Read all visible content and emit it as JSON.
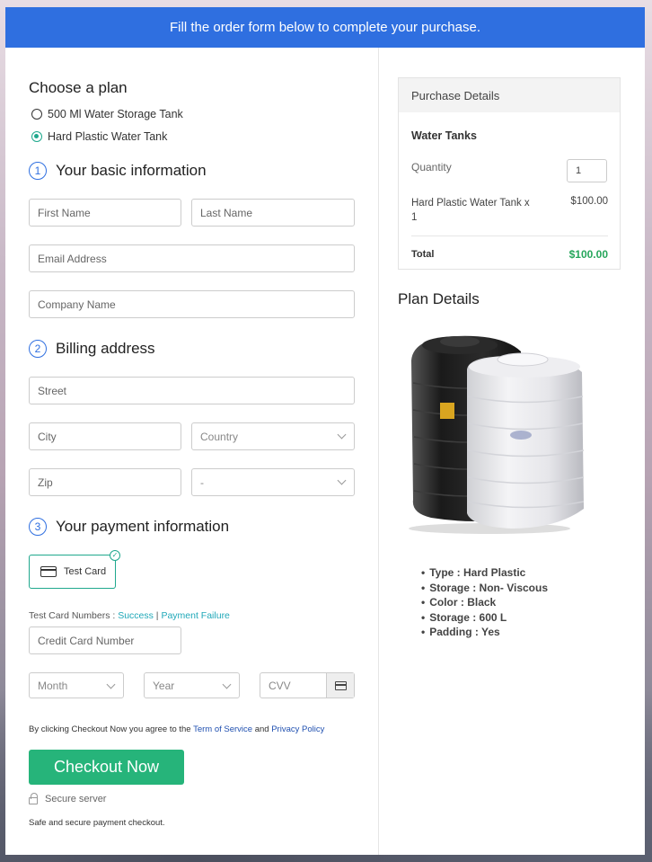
{
  "banner": "Fill the order form below to complete your purchase.",
  "plan": {
    "heading": "Choose a plan",
    "options": [
      "500 Ml Water Storage Tank",
      "Hard Plastic Water Tank"
    ],
    "selected_index": 1
  },
  "basic": {
    "number": "1",
    "title": "Your basic information",
    "first_name": "First Name",
    "last_name": "Last Name",
    "email": "Email Address",
    "company": "Company Name"
  },
  "billing": {
    "number": "2",
    "title": "Billing address",
    "street": "Street",
    "city": "City",
    "country": "Country",
    "zip": "Zip",
    "state": "-"
  },
  "payment": {
    "number": "3",
    "title": "Your payment information",
    "test_card": "Test Card",
    "test_numbers_label": "Test Card Numbers : ",
    "success": "Success",
    "separator": " | ",
    "failure": "Payment Failure",
    "card_number": "Credit Card Number",
    "month": "Month",
    "year": "Year",
    "cvv": "CVV"
  },
  "agree": {
    "prefix": "By clicking Checkout Now you agree to the ",
    "terms": "Term of Service",
    "and": " and ",
    "privacy": "Privacy Policy"
  },
  "checkout_button": "Checkout Now",
  "secure": "Secure server",
  "safe": "Safe and secure payment checkout.",
  "purchase": {
    "heading": "Purchase Details",
    "product_group": "Water Tanks",
    "quantity_label": "Quantity",
    "quantity": "1",
    "item": "Hard Plastic Water Tank x 1",
    "item_price": "$100.00",
    "total_label": "Total",
    "total_price": "$100.00"
  },
  "plan_details": {
    "title": "Plan Details",
    "specs": [
      "Type : Hard Plastic",
      "Storage : Non- Viscous",
      "Color : Black",
      "Storage : 600 L",
      "Padding : Yes"
    ]
  },
  "colors": {
    "banner": "#2f6fe0",
    "accent_teal": "#1fa88d",
    "checkout": "#26b47a",
    "total_green": "#26a65b"
  }
}
